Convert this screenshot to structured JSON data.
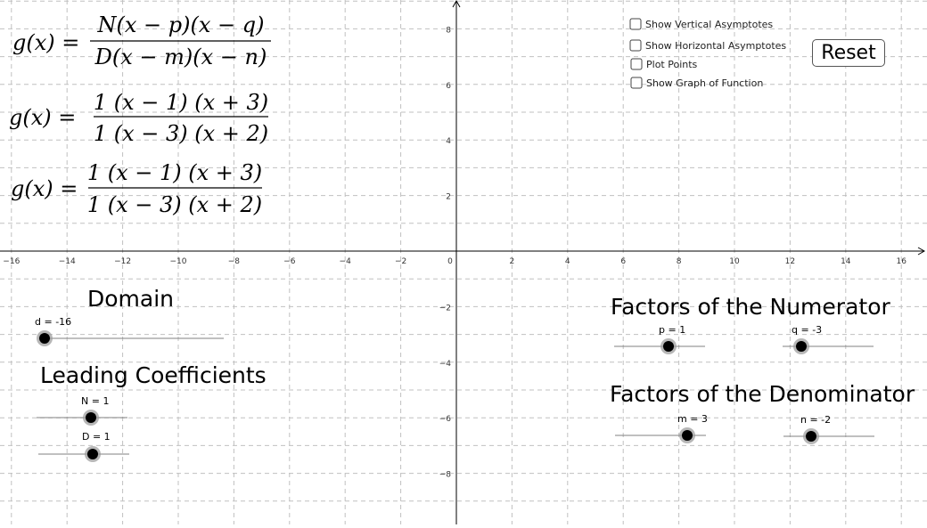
{
  "formulas": {
    "general_lhs": "g(x) =",
    "general_num": "N(x − p)(x − q)",
    "general_den": "D(x − m)(x − n)",
    "spec1_lhs": "g(x)  =",
    "spec1_num": "1 (x − 1) (x + 3)",
    "spec1_den": "1 (x − 3) (x + 2)",
    "spec2_lhs": "g(x) =",
    "spec2_num": "1 (x − 1) (x + 3)",
    "spec2_den": "1 (x − 3) (x + 2)"
  },
  "checkboxes": [
    {
      "label": "Show Vertical Asymptotes",
      "checked": false
    },
    {
      "label": "Show Horizontal Asymptotes",
      "checked": false
    },
    {
      "label": "Plot Points",
      "checked": false
    },
    {
      "label": "Show Graph of Function",
      "checked": false
    }
  ],
  "reset_label": "Reset",
  "axis": {
    "x_ticks": [
      "−16",
      "−14",
      "−12",
      "−10",
      "−8",
      "−6",
      "−4",
      "−2",
      "0",
      "2",
      "4",
      "6",
      "8",
      "10",
      "12",
      "14",
      "16"
    ],
    "y_ticks_pos": [
      "8",
      "6",
      "4",
      "2"
    ],
    "y_ticks_neg": [
      "−2",
      "−4",
      "−6",
      "−8"
    ]
  },
  "headings": {
    "domain": "Domain",
    "leading": "Leading Coefficients",
    "numerator": "Factors of the Numerator",
    "denominator": "Factors of the Denominator"
  },
  "sliders": {
    "d": {
      "caption": "d = -16",
      "value": -16
    },
    "N": {
      "caption": "N = 1",
      "value": 1
    },
    "D": {
      "caption": "D = 1",
      "value": 1
    },
    "p": {
      "caption": "p = 1",
      "value": 1
    },
    "q": {
      "caption": "q = -3",
      "value": -3
    },
    "m": {
      "caption": "m = 3",
      "value": 3
    },
    "n": {
      "caption": "n = -2",
      "value": -2
    }
  },
  "colors": {
    "grid": "#c0c0c0",
    "axis": "#000000",
    "slider_track": "#808080",
    "slider_dot": "#000000",
    "slider_halo": "#999999"
  }
}
